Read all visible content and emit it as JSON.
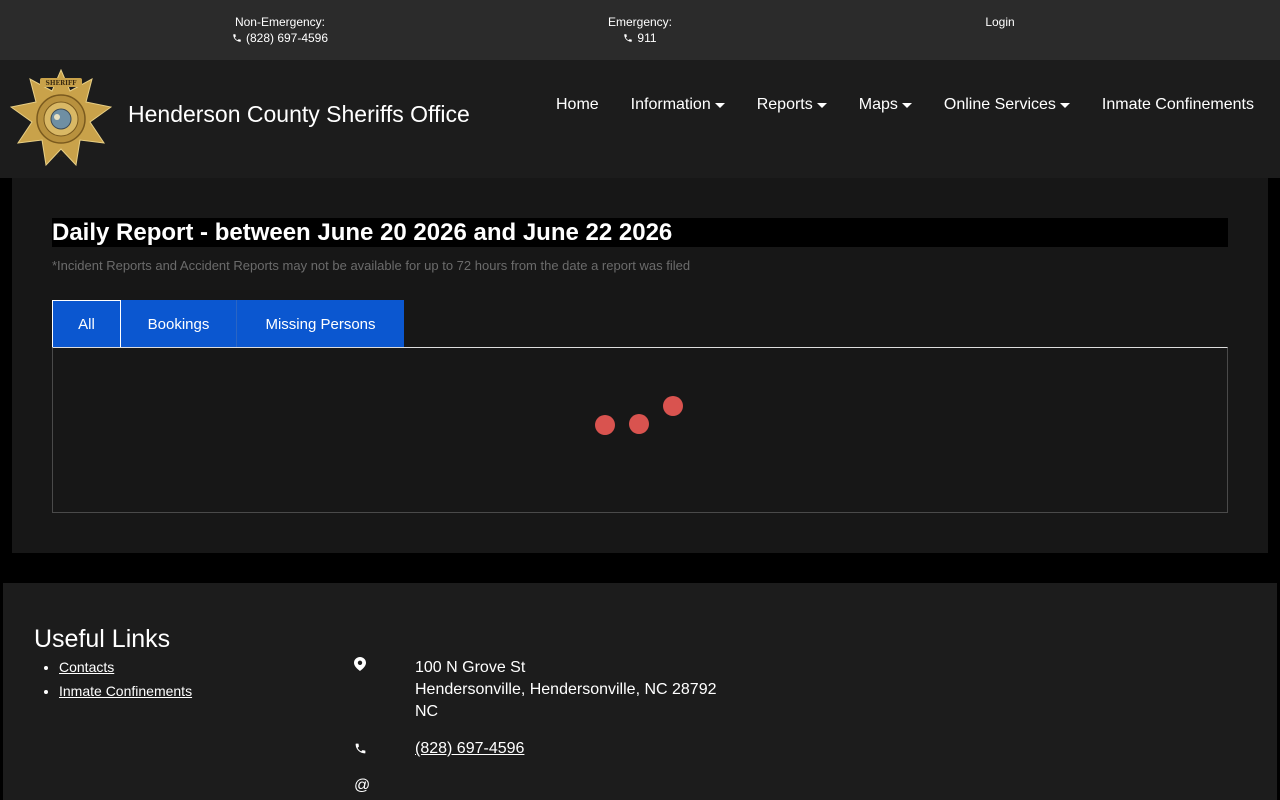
{
  "topbar": {
    "non_emergency_label": "Non-Emergency:",
    "non_emergency_phone": "(828) 697-4596",
    "emergency_label": "Emergency:",
    "emergency_phone": "911",
    "login": "Login"
  },
  "header": {
    "brand": "Henderson County Sheriffs Office",
    "badge_text_top": "SHERIFF",
    "badge_text_ring": "HENDERSON COUNTY",
    "badge_text_bottom": "SHERIFF'S OFFICE",
    "badge_state": "NC"
  },
  "nav": {
    "home": "Home",
    "information": "Information",
    "reports": "Reports",
    "maps": "Maps",
    "online_services": "Online Services",
    "inmate_confinements": "Inmate Confinements"
  },
  "report": {
    "title": "Daily Report - between June 20 2026 and June 22 2026",
    "note": "*Incident Reports and Accident Reports may not be available for up to 72 hours from the date a report was filed",
    "tabs": [
      {
        "label": "All"
      },
      {
        "label": "Bookings"
      },
      {
        "label": "Missing Persons"
      }
    ]
  },
  "footer": {
    "heading": "Useful Links",
    "links": [
      {
        "label": "Contacts"
      },
      {
        "label": "Inmate Confinements"
      }
    ],
    "address_line1": "100 N Grove St",
    "address_line2": "Hendersonville, Hendersonville, NC 28792",
    "address_line3": "NC",
    "phone": "(828) 697-4596",
    "email_symbol": "@"
  },
  "colors": {
    "accent": "#0b57d0",
    "loader": "#d9534f",
    "badge_gold": "#c9a24a"
  }
}
